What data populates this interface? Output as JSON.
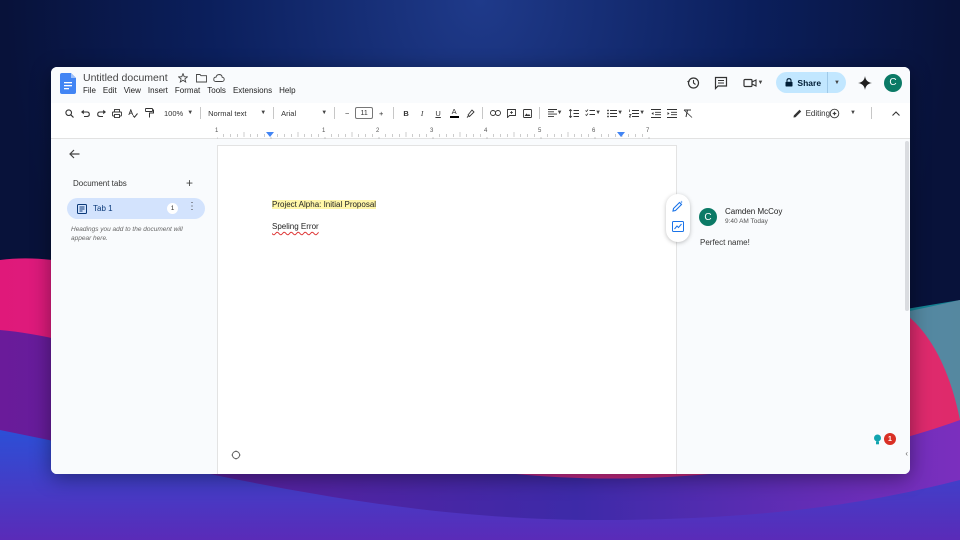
{
  "colors": {
    "accent": "#1a73e8",
    "share_bg": "#c2e7ff",
    "avatar": "#0b7a66",
    "tab_selected": "#d3e3fd",
    "highlight": "#fff6a8",
    "notif_badge": "#d93025"
  },
  "doc": {
    "title": "Untitled document",
    "icons": [
      "star-icon",
      "folder-icon",
      "cloud-icon"
    ]
  },
  "menu": [
    "File",
    "Edit",
    "View",
    "Insert",
    "Format",
    "Tools",
    "Extensions",
    "Help"
  ],
  "top_right": {
    "share_label": "Share",
    "avatar_letter": "C",
    "icons": [
      "history-icon",
      "comments-icon",
      "meet-icon",
      "gemini-icon"
    ]
  },
  "toolbar": {
    "zoom": "100%",
    "style": "Normal text",
    "font": "Arial",
    "font_size": "11",
    "mode": "Editing"
  },
  "ruler": {
    "numbers": [
      "1",
      "1",
      "2",
      "3",
      "4",
      "5",
      "6",
      "7"
    ]
  },
  "sidebar": {
    "heading": "Document tabs",
    "tab_label": "Tab 1",
    "tab_badge": "1",
    "hint": "Headings you add to the document will appear here."
  },
  "page": {
    "line1": "Project Alpha: Initial Proposal",
    "line2": "Speling Error"
  },
  "comment": {
    "avatar_letter": "C",
    "author": "Camden McCoy",
    "time": "9:40 AM Today",
    "text": "Perfect name!"
  },
  "notifications": {
    "count": "1"
  }
}
